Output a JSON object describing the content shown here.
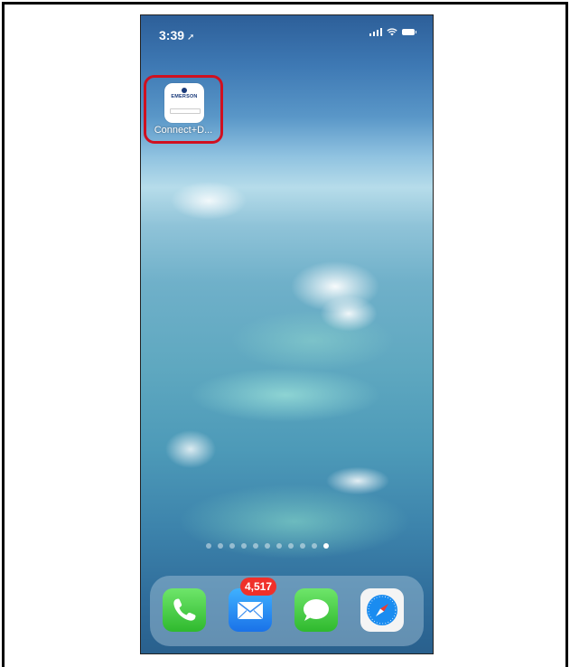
{
  "status_bar": {
    "time": "3:39",
    "location_icon": "location-arrow-icon",
    "signal_icon": "signal-bars-icon",
    "wifi_icon": "wifi-icon",
    "battery_icon": "battery-icon"
  },
  "home_apps": [
    {
      "label": "Connect+D...",
      "icon_brand": "EMERSON",
      "highlight_color": "#d01020"
    }
  ],
  "page_dots": {
    "count": 11,
    "active_index": 10
  },
  "dock": {
    "apps": [
      {
        "name": "Phone",
        "icon": "phone-icon"
      },
      {
        "name": "Mail",
        "icon": "mail-icon",
        "badge": "4,517"
      },
      {
        "name": "Messages",
        "icon": "messages-icon"
      },
      {
        "name": "Safari",
        "icon": "safari-compass-icon"
      }
    ]
  },
  "colors": {
    "badge": "#f0302a",
    "highlight": "#d01020"
  }
}
